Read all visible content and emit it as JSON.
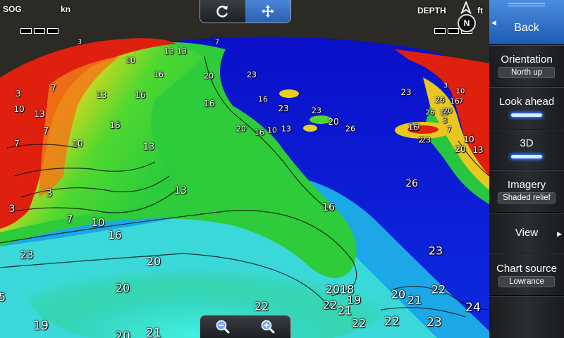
{
  "hud": {
    "sog_label": "SOG",
    "speed_unit": "kn",
    "depth_label": "DEPTH",
    "depth_unit": "ft",
    "north_symbol": "N"
  },
  "toolbar": {
    "rotate_icon": "rotate-icon",
    "pan_icon": "pan-move-icon"
  },
  "zoom": {
    "zoom_out_icon": "zoom-out-icon",
    "zoom_in_icon": "zoom-in-icon"
  },
  "sidebar": {
    "back_label": "Back",
    "orientation": {
      "label": "Orientation",
      "value": "North up"
    },
    "look_ahead": {
      "label": "Look ahead",
      "enabled": true
    },
    "three_d": {
      "label": "3D",
      "enabled": true
    },
    "imagery": {
      "label": "Imagery",
      "value": "Shaded relief"
    },
    "view": {
      "label": "View"
    },
    "chart_source": {
      "label": "Chart source",
      "value": "Lowrance"
    }
  },
  "colors": {
    "land": "#2b2a25",
    "shallow": "#e01a10",
    "mid": "#e8d020",
    "green": "#2fcf2f",
    "deep": "#0a1ad6",
    "accent": "#2c7bff"
  },
  "depth_labels": [
    {
      "text": "3"
    },
    {
      "text": "13"
    },
    {
      "text": "10"
    },
    {
      "text": "7"
    },
    {
      "text": "13"
    },
    {
      "text": "16"
    },
    {
      "text": "20"
    },
    {
      "text": "23"
    },
    {
      "text": "3"
    },
    {
      "text": "7"
    },
    {
      "text": "10"
    },
    {
      "text": "13"
    },
    {
      "text": "13"
    },
    {
      "text": "16"
    },
    {
      "text": "16"
    },
    {
      "text": "16"
    },
    {
      "text": "23"
    },
    {
      "text": "23"
    },
    {
      "text": "20"
    },
    {
      "text": "26"
    },
    {
      "text": "7"
    },
    {
      "text": "16"
    },
    {
      "text": "10"
    },
    {
      "text": "13"
    },
    {
      "text": "16"
    },
    {
      "text": "20"
    },
    {
      "text": "23"
    },
    {
      "text": "3"
    },
    {
      "text": "10"
    },
    {
      "text": "7"
    },
    {
      "text": "26"
    },
    {
      "text": "16"
    },
    {
      "text": "10"
    },
    {
      "text": "26"
    },
    {
      "text": "19"
    },
    {
      "text": "20"
    },
    {
      "text": "3"
    },
    {
      "text": "7"
    },
    {
      "text": "16"
    },
    {
      "text": "23"
    },
    {
      "text": "2"
    },
    {
      "text": "10"
    },
    {
      "text": "20"
    },
    {
      "text": "13"
    },
    {
      "text": "10"
    },
    {
      "text": "13"
    },
    {
      "text": "7"
    },
    {
      "text": "3"
    },
    {
      "text": "26"
    },
    {
      "text": "3"
    },
    {
      "text": "7"
    },
    {
      "text": "10"
    },
    {
      "text": "16"
    },
    {
      "text": "16"
    },
    {
      "text": "13"
    },
    {
      "text": "20"
    },
    {
      "text": "23"
    },
    {
      "text": "20"
    },
    {
      "text": "2018"
    },
    {
      "text": "19"
    },
    {
      "text": "22"
    },
    {
      "text": "21"
    },
    {
      "text": "20"
    },
    {
      "text": "21"
    },
    {
      "text": "22"
    },
    {
      "text": "22"
    },
    {
      "text": "24"
    },
    {
      "text": "22"
    },
    {
      "text": "22"
    },
    {
      "text": "23"
    },
    {
      "text": "23"
    },
    {
      "text": "19"
    },
    {
      "text": "20"
    },
    {
      "text": "21"
    },
    {
      "text": "5"
    }
  ]
}
